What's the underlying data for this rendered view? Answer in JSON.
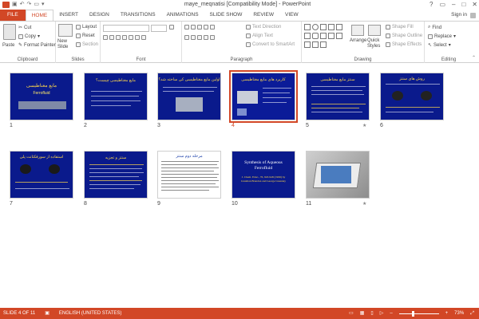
{
  "window": {
    "title": "maye_meqnatisi [Compatibility Mode] - PowerPoint",
    "controls": [
      "?",
      "▭",
      "–",
      "□",
      "✕"
    ]
  },
  "tabs": [
    "FILE",
    "HOME",
    "INSERT",
    "DESIGN",
    "TRANSITIONS",
    "ANIMATIONS",
    "SLIDE SHOW",
    "REVIEW",
    "VIEW"
  ],
  "active_tab": "HOME",
  "signin": "Sign in",
  "ribbon": {
    "clipboard": {
      "paste": "Paste",
      "cut": "Cut",
      "copy": "Copy",
      "format_painter": "Format Painter",
      "label": "Clipboard"
    },
    "slides": {
      "new_slide": "New Slide",
      "layout": "Layout",
      "reset": "Reset",
      "section": "Section",
      "label": "Slides"
    },
    "font": {
      "label": "Font"
    },
    "paragraph": {
      "text_direction": "Text Direction",
      "align_text": "Align Text",
      "convert_smartart": "Convert to SmartArt",
      "label": "Paragraph"
    },
    "drawing": {
      "arrange": "Arrange",
      "quick_styles": "Quick Styles",
      "shape_fill": "Shape Fill",
      "shape_outline": "Shape Outline",
      "shape_effects": "Shape Effects",
      "label": "Drawing"
    },
    "editing": {
      "find": "Find",
      "replace": "Replace",
      "select": "Select",
      "label": "Editing"
    }
  },
  "slides": [
    {
      "number": "1",
      "title": "مایع مغناطیسی",
      "subtitle": "Ferrofluid"
    },
    {
      "number": "2",
      "title": "مایع مغناطیسی چیست؟"
    },
    {
      "number": "3",
      "title": "اولین مایع مغناطیسی کی ساخته شد؟"
    },
    {
      "number": "4",
      "title": "کاربرد های مایع مغناطیسی"
    },
    {
      "number": "5",
      "title": "سنتز مایع مغناطیسی"
    },
    {
      "number": "6",
      "title": "روش های سنتز"
    },
    {
      "number": "7",
      "title": "استفاده از سورفکتانت پلی"
    },
    {
      "number": "8",
      "title": "سنتز و تجزیه"
    },
    {
      "number": "9",
      "title": "مرحله دوم سنتز"
    },
    {
      "number": "10",
      "title": "Synthesis of Aqueous Ferrofluid",
      "body": "J. Chem. Educ., 76, 943-948 (1999) by Jonathan Brandon and George Lisensky"
    },
    {
      "number": "11"
    }
  ],
  "selected_slide": 4,
  "statusbar": {
    "slide": "SLIDE 4 OF 11",
    "language": "ENGLISH (UNITED STATES)",
    "zoom": "73%"
  },
  "colors": {
    "accent": "#d24726",
    "slide_blue": "#0a1a8c",
    "slide_title_yellow": "#ffd84a"
  }
}
